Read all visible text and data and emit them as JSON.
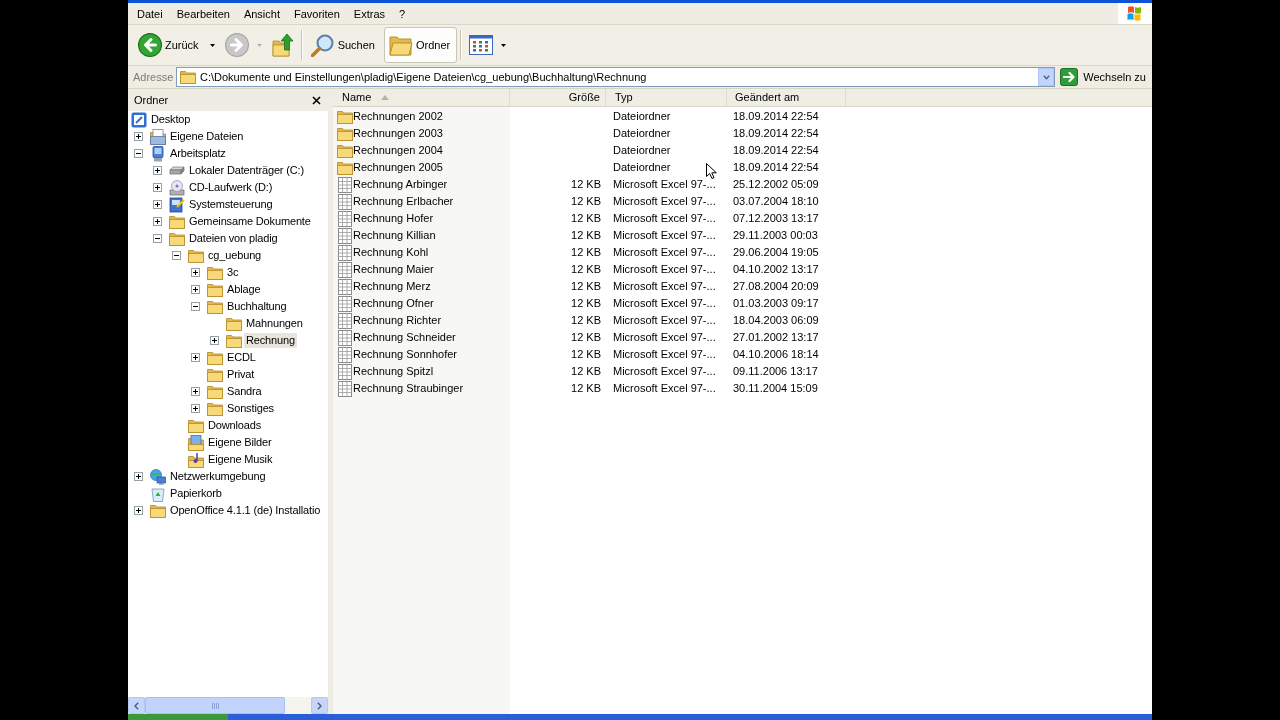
{
  "menu": [
    "Datei",
    "Bearbeiten",
    "Ansicht",
    "Favoriten",
    "Extras",
    "?"
  ],
  "toolbar": {
    "groups": [
      [
        {
          "kind": "back",
          "label": "Zurück",
          "dropdown": true,
          "disabled": false,
          "pressed": false
        },
        {
          "kind": "forward",
          "dropdown": true,
          "disabled": true,
          "pressed": false
        },
        {
          "kind": "up",
          "dropdown": false,
          "disabled": false,
          "pressed": false
        }
      ],
      [
        {
          "kind": "search",
          "label": "Suchen",
          "dropdown": false,
          "disabled": false,
          "pressed": false
        },
        {
          "kind": "folders",
          "label": "Ordner",
          "dropdown": false,
          "disabled": false,
          "pressed": true
        }
      ],
      [
        {
          "kind": "views",
          "dropdown": true,
          "disabled": false,
          "pressed": false
        }
      ]
    ]
  },
  "address": {
    "label": "Adresse",
    "value": "C:\\Dokumente und Einstellungen\\pladig\\Eigene Dateien\\cg_uebung\\Buchhaltung\\Rechnung",
    "go_button": "Wechseln zu"
  },
  "folder_pane": {
    "title": "Ordner",
    "tree": [
      {
        "label": "Desktop",
        "kind": "desktop",
        "selected": false,
        "children": [
          {
            "label": "Eigene Dateien",
            "kind": "documents",
            "expanded": false,
            "selected": false
          },
          {
            "label": "Arbeitsplatz",
            "kind": "computer",
            "expanded": true,
            "selected": false,
            "children": [
              {
                "label": "Lokaler Datenträger (C:)",
                "kind": "drive",
                "expanded": false,
                "selected": false
              },
              {
                "label": "CD-Laufwerk (D:)",
                "kind": "cd-drive",
                "expanded": false,
                "selected": false
              },
              {
                "label": "Systemsteuerung",
                "kind": "control-panel",
                "expanded": false,
                "selected": false
              },
              {
                "label": "Gemeinsame Dokumente",
                "kind": "folder",
                "expanded": false,
                "selected": false
              },
              {
                "label": "Dateien von pladig",
                "kind": "folder",
                "expanded": true,
                "selected": false,
                "children": [
                  {
                    "label": "cg_uebung",
                    "kind": "folder",
                    "expanded": true,
                    "selected": false,
                    "children": [
                      {
                        "label": "3c",
                        "kind": "folder",
                        "expanded": false,
                        "selected": false
                      },
                      {
                        "label": "Ablage",
                        "kind": "folder",
                        "expanded": false,
                        "selected": false
                      },
                      {
                        "label": "Buchhaltung",
                        "kind": "folder",
                        "expanded": true,
                        "selected": false,
                        "children": [
                          {
                            "label": "Mahnungen",
                            "kind": "folder",
                            "selected": false
                          },
                          {
                            "label": "Rechnung",
                            "kind": "folder",
                            "expanded": false,
                            "selected": true
                          }
                        ]
                      },
                      {
                        "label": "ECDL",
                        "kind": "folder",
                        "expanded": false,
                        "selected": false
                      },
                      {
                        "label": "Privat",
                        "kind": "folder",
                        "selected": false
                      },
                      {
                        "label": "Sandra",
                        "kind": "folder",
                        "expanded": false,
                        "selected": false
                      },
                      {
                        "label": "Sonstiges",
                        "kind": "folder",
                        "expanded": false,
                        "selected": false
                      }
                    ]
                  },
                  {
                    "label": "Downloads",
                    "kind": "folder",
                    "selected": false
                  },
                  {
                    "label": "Eigene Bilder",
                    "kind": "pictures",
                    "selected": false
                  },
                  {
                    "label": "Eigene Musik",
                    "kind": "music",
                    "selected": false
                  }
                ]
              }
            ]
          },
          {
            "label": "Netzwerkumgebung",
            "kind": "network",
            "expanded": false,
            "selected": false
          },
          {
            "label": "Papierkorb",
            "kind": "recycle-bin",
            "selected": false
          },
          {
            "label": "OpenOffice 4.1.1 (de) Installatio",
            "kind": "folder",
            "expanded": false,
            "selected": false
          }
        ]
      }
    ]
  },
  "list": {
    "columns": [
      {
        "label": "Name",
        "sorted": true
      },
      {
        "label": "Größe",
        "sorted": false
      },
      {
        "label": "Typ",
        "sorted": false
      },
      {
        "label": "Geändert am",
        "sorted": false
      }
    ],
    "rows": [
      {
        "kind": "folder",
        "name": "Rechnungen 2002",
        "type": "Dateiordner",
        "modified": "18.09.2014 22:54"
      },
      {
        "kind": "folder",
        "name": "Rechnungen 2003",
        "type": "Dateiordner",
        "modified": "18.09.2014 22:54"
      },
      {
        "kind": "folder",
        "name": "Rechnungen 2004",
        "type": "Dateiordner",
        "modified": "18.09.2014 22:54"
      },
      {
        "kind": "folder",
        "name": "Rechnungen 2005",
        "type": "Dateiordner",
        "modified": "18.09.2014 22:54"
      },
      {
        "kind": "spreadsheet",
        "name": "Rechnung Arbinger",
        "size": "12 KB",
        "type": "Microsoft Excel 97-...",
        "modified": "25.12.2002 05:09"
      },
      {
        "kind": "spreadsheet",
        "name": "Rechnung Erlbacher",
        "size": "12 KB",
        "type": "Microsoft Excel 97-...",
        "modified": "03.07.2004 18:10"
      },
      {
        "kind": "spreadsheet",
        "name": "Rechnung Hofer",
        "size": "12 KB",
        "type": "Microsoft Excel 97-...",
        "modified": "07.12.2003 13:17"
      },
      {
        "kind": "spreadsheet",
        "name": "Rechnung Killian",
        "size": "12 KB",
        "type": "Microsoft Excel 97-...",
        "modified": "29.11.2003 00:03"
      },
      {
        "kind": "spreadsheet",
        "name": "Rechnung Kohl",
        "size": "12 KB",
        "type": "Microsoft Excel 97-...",
        "modified": "29.06.2004 19:05"
      },
      {
        "kind": "spreadsheet",
        "name": "Rechnung Maier",
        "size": "12 KB",
        "type": "Microsoft Excel 97-...",
        "modified": "04.10.2002 13:17"
      },
      {
        "kind": "spreadsheet",
        "name": "Rechnung Merz",
        "size": "12 KB",
        "type": "Microsoft Excel 97-...",
        "modified": "27.08.2004 20:09"
      },
      {
        "kind": "spreadsheet",
        "name": "Rechnung Ofner",
        "size": "12 KB",
        "type": "Microsoft Excel 97-...",
        "modified": "01.03.2003 09:17"
      },
      {
        "kind": "spreadsheet",
        "name": "Rechnung Richter",
        "size": "12 KB",
        "type": "Microsoft Excel 97-...",
        "modified": "18.04.2003 06:09"
      },
      {
        "kind": "spreadsheet",
        "name": "Rechnung Schneider",
        "size": "12 KB",
        "type": "Microsoft Excel 97-...",
        "modified": "27.01.2002 13:17"
      },
      {
        "kind": "spreadsheet",
        "name": "Rechnung Sonnhofer",
        "size": "12 KB",
        "type": "Microsoft Excel 97-...",
        "modified": "04.10.2006 18:14"
      },
      {
        "kind": "spreadsheet",
        "name": "Rechnung Spitzl",
        "size": "12 KB",
        "type": "Microsoft Excel 97-...",
        "modified": "09.11.2006 13:17"
      },
      {
        "kind": "spreadsheet",
        "name": "Rechnung Straubinger",
        "size": "12 KB",
        "type": "Microsoft Excel 97-...",
        "modified": "30.11.2004 15:09"
      }
    ]
  }
}
